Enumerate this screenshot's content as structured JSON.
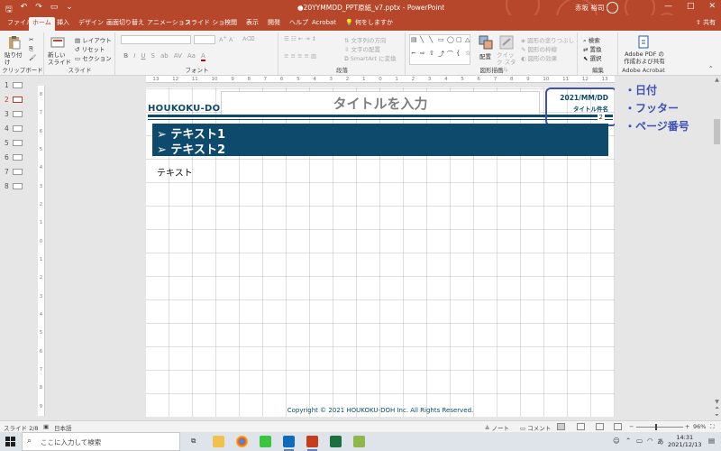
{
  "window": {
    "doc_title": "●20YYMMDD_PPT原紙_v7.pptx - PowerPoint",
    "user_name": "赤坂 裕司",
    "controls": [
      "—",
      "□",
      "✕"
    ]
  },
  "tabs": [
    "ファイル",
    "ホーム",
    "挿入",
    "デザイン",
    "画面切り替え",
    "アニメーション",
    "スライド ショー",
    "校閲",
    "表示",
    "開発",
    "ヘルプ",
    "Acrobat"
  ],
  "tell_me": "何をしますか",
  "share": "共有",
  "ribbon": {
    "clipboard": {
      "paste": "貼り付け",
      "label": "クリップボード"
    },
    "slides": {
      "new_slide": "新しい スライド",
      "layout": "レイアウト",
      "reset": "リセット",
      "section": "セクション",
      "label": "スライド"
    },
    "font": {
      "label": "フォント",
      "buttons": [
        "B",
        "I",
        "U",
        "S",
        "ab",
        "AV",
        "Aa",
        "A"
      ]
    },
    "paragraph": {
      "label": "段落",
      "text_direction": "文字列の方向",
      "align_text": "文字の配置",
      "smartart": "SmartArt に変換"
    },
    "drawing": {
      "label": "図形描画",
      "arrange": "配置",
      "quick_styles": "クイック スタイル",
      "fill": "図形の塗りつぶし",
      "outline": "図形の枠線",
      "effects": "図形の効果"
    },
    "editing": {
      "label": "編集",
      "find": "検索",
      "replace": "置換",
      "select": "選択"
    },
    "acrobat": {
      "create_pdf": "Adobe PDF の 作成および共有",
      "label": "Adobe Acrobat"
    }
  },
  "slide_numbers": [
    "1",
    "2",
    "3",
    "4",
    "5",
    "6",
    "7",
    "8"
  ],
  "ruler_h": [
    "13",
    "12",
    "11",
    "10",
    "9",
    "8",
    "7",
    "6",
    "5",
    "4",
    "3",
    "2",
    "1",
    "0",
    "1",
    "2",
    "3",
    "4",
    "5",
    "6",
    "7",
    "8",
    "9",
    "10",
    "11",
    "12",
    "13"
  ],
  "ruler_v": [
    "8",
    "7",
    "6",
    "5",
    "4",
    "3",
    "2",
    "1",
    "0",
    "1",
    "2",
    "3",
    "4",
    "5",
    "6",
    "7",
    "8",
    "9"
  ],
  "slide": {
    "logo": "HOUKOKU-DOH",
    "title": "タイトルを入力",
    "date": "2021/MM/DD",
    "subject": "タイトル件名",
    "page_number": "2",
    "banner_lines": [
      "➢ テキスト1",
      "➢ テキスト2"
    ],
    "body_text": "テキスト",
    "copyright": "Copyright © 2021 HOUKOKU-DOH Inc. All Rights Reserved."
  },
  "annotations": [
    "・日付",
    "・フッター",
    "・ページ番号"
  ],
  "status": {
    "slide_pos": "スライド 2/8",
    "language": "日本語",
    "notes": "ノート",
    "comments": "コメント",
    "zoom": "96%"
  },
  "taskbar": {
    "search_placeholder": "ここに入力して検索",
    "ime": "あ",
    "time": "14:31",
    "date": "2021/12/13"
  }
}
